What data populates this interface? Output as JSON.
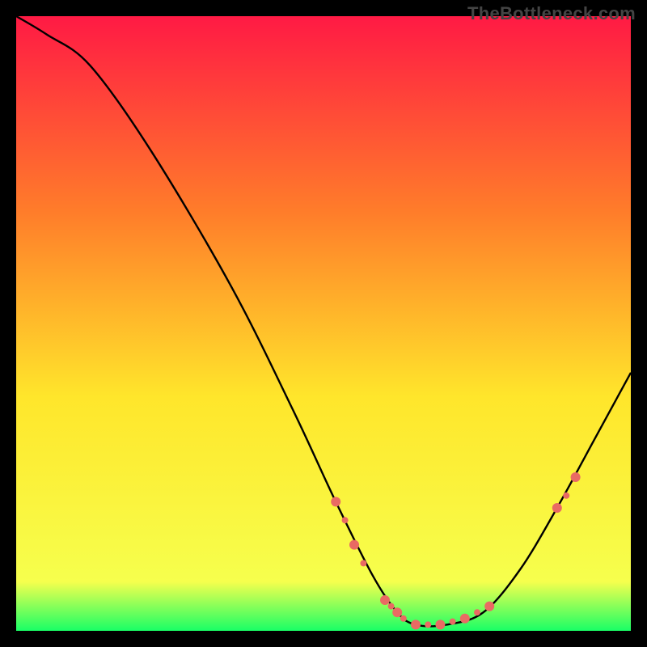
{
  "watermark": "TheBottleneck.com",
  "chart_data": {
    "type": "line",
    "title": "",
    "xlabel": "",
    "ylabel": "",
    "xlim": [
      0,
      100
    ],
    "ylim": [
      0,
      100
    ],
    "grid": false,
    "background_gradient": {
      "top": "#ff1a44",
      "mid1": "#ff7d2a",
      "mid2": "#ffe62b",
      "near_bottom": "#f6ff4d",
      "bottom": "#19ff66"
    },
    "series": [
      {
        "name": "bottleneck-curve",
        "stroke": "#000000",
        "x": [
          0,
          5,
          12,
          22,
          35,
          45,
          52,
          58,
          62,
          65,
          70,
          76,
          82,
          88,
          94,
          100
        ],
        "values": [
          100,
          97,
          92,
          78,
          56,
          36,
          21,
          9,
          3,
          1,
          1,
          3,
          10,
          20,
          31,
          42
        ]
      }
    ],
    "markers": {
      "name": "highlight-dots",
      "color": "#e96a63",
      "radius_small": 4,
      "radius_large": 6,
      "points": [
        {
          "x": 52,
          "y": 21,
          "r": 6
        },
        {
          "x": 53.5,
          "y": 18,
          "r": 4
        },
        {
          "x": 55,
          "y": 14,
          "r": 6
        },
        {
          "x": 56.5,
          "y": 11,
          "r": 4
        },
        {
          "x": 60,
          "y": 5,
          "r": 6
        },
        {
          "x": 61,
          "y": 4,
          "r": 4
        },
        {
          "x": 62,
          "y": 3,
          "r": 6
        },
        {
          "x": 63,
          "y": 2,
          "r": 4
        },
        {
          "x": 65,
          "y": 1,
          "r": 6
        },
        {
          "x": 67,
          "y": 1,
          "r": 4
        },
        {
          "x": 69,
          "y": 1,
          "r": 6
        },
        {
          "x": 71,
          "y": 1.5,
          "r": 4
        },
        {
          "x": 73,
          "y": 2,
          "r": 6
        },
        {
          "x": 75,
          "y": 3,
          "r": 4
        },
        {
          "x": 77,
          "y": 4,
          "r": 6
        },
        {
          "x": 88,
          "y": 20,
          "r": 6
        },
        {
          "x": 89.5,
          "y": 22,
          "r": 4
        },
        {
          "x": 91,
          "y": 25,
          "r": 6
        }
      ]
    }
  }
}
